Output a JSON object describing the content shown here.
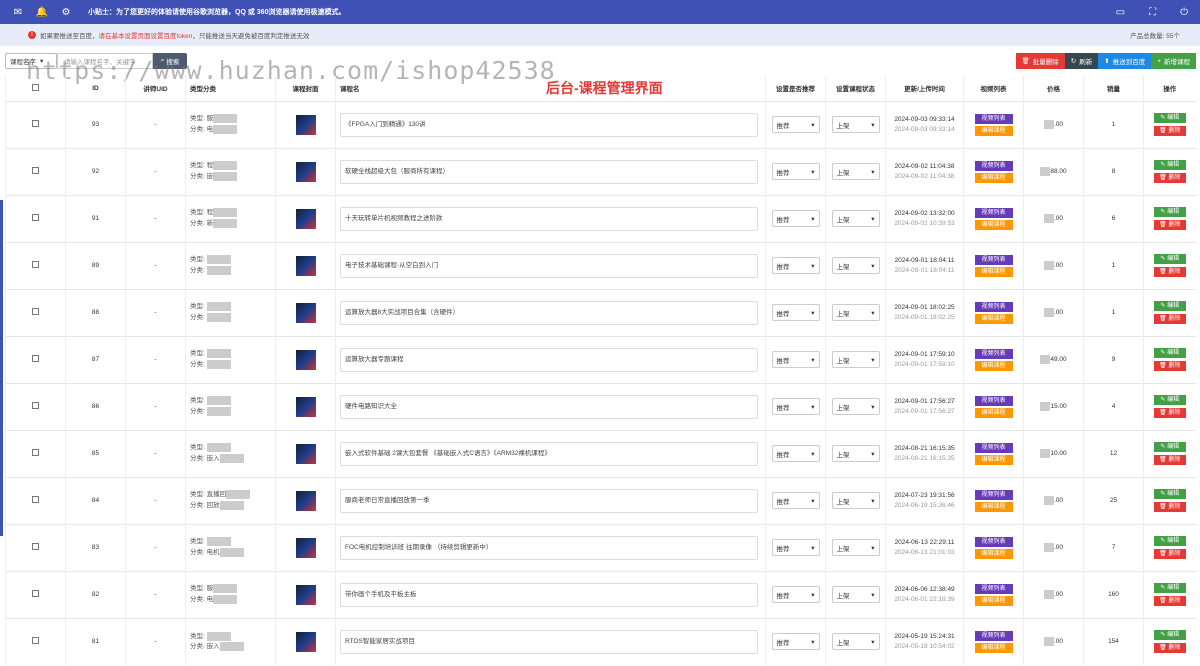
{
  "topbar": {
    "tip": "小贴士：为了您更好的体验请使用谷歌浏览器，QQ 或 360浏览器请使用极速模式。",
    "icons": [
      "mail-icon",
      "bell-icon",
      "gear-icon",
      "window-icon",
      "fullscreen-icon",
      "power-icon"
    ]
  },
  "notice": {
    "prefix": "如果要推送至百度，",
    "highlight": "请在基本设置页面设置百度token",
    "suffix": "，只能推送当天避免被百度判定推送无效",
    "product_count": "产品总数量: 55个"
  },
  "toolbar": {
    "select_field": "课程名字",
    "search_placeholder": "请输入课程名字、关键字",
    "search_label": "搜索",
    "batch_delete": "批量删除",
    "refresh": "刷新",
    "push_baidu": "推送到百度",
    "add_course": "新增课程"
  },
  "watermark": "https://www.huzhan.com/ishop42538",
  "page_title": "后台-课程管理界面",
  "table": {
    "headers": [
      "ID",
      "讲师UID",
      "类型分类",
      "课程封面",
      "课程名",
      "设置是否推荐",
      "设置课程状态",
      "更新/上传时间",
      "视频列表",
      "价格",
      "销量",
      "操作"
    ],
    "video_list_label": "视频列表",
    "edit_course_label": "编辑课程",
    "edit_label": "编辑",
    "delete_label": "删除",
    "rows": [
      {
        "id": "93",
        "uid": "-",
        "type1": "类型: 服",
        "type2": "分类: 电",
        "name": "《FPGA入门到精通》130讲",
        "recommend": "推荐",
        "status": "上架",
        "time1": "2024-09-03 09:33:14",
        "time2": "2024-09-03 09:33:14",
        "price": ".00",
        "sales": "1"
      },
      {
        "id": "92",
        "uid": "-",
        "type1": "类型: 程",
        "type2": "分类: 嵌",
        "name": "软硬全栈超级大包（服商所有课程）",
        "recommend": "推荐",
        "status": "上架",
        "time1": "2024-09-02 11:04:38",
        "time2": "2024-09-02 11:04:38",
        "price": "88.00",
        "sales": "8"
      },
      {
        "id": "91",
        "uid": "-",
        "type1": "类型: 程",
        "type2": "分类: 新",
        "name": "十天玩转单片机视频教程之进阶款",
        "recommend": "推荐",
        "status": "上架",
        "time1": "2024-09-02 13:32:00",
        "time2": "2024-09-02 10:39:53",
        "price": ".00",
        "sales": "6"
      },
      {
        "id": "89",
        "uid": "-",
        "type1": "类型: ",
        "type2": "分类: ",
        "name": "电子技术基础课程-从空白到入门",
        "recommend": "推荐",
        "status": "上架",
        "time1": "2024-09-01 18:04:11",
        "time2": "2024-09-01 18:04:11",
        "price": ".00",
        "sales": "1"
      },
      {
        "id": "88",
        "uid": "-",
        "type1": "类型: ",
        "type2": "分类: ",
        "name": "运算放大器8大实战项目合集（含硬件）",
        "recommend": "推荐",
        "status": "上架",
        "time1": "2024-09-01 18:02:25",
        "time2": "2024-09-01 18:02:25",
        "price": ".00",
        "sales": "1"
      },
      {
        "id": "87",
        "uid": "-",
        "type1": "类型: ",
        "type2": "分类: ",
        "name": "运算放大器专题课程",
        "recommend": "推荐",
        "status": "上架",
        "time1": "2024-09-01 17:59:10",
        "time2": "2024-09-01 17:59:10",
        "price": "49.00",
        "sales": "9"
      },
      {
        "id": "86",
        "uid": "-",
        "type1": "类型: ",
        "type2": "分类: ",
        "name": "硬件电路知识大全",
        "recommend": "推荐",
        "status": "上架",
        "time1": "2024-09-01 17:56:27",
        "time2": "2024-09-01 17:56:27",
        "price": "15.00",
        "sales": "4"
      },
      {
        "id": "85",
        "uid": "-",
        "type1": "类型: ",
        "type2": "分类: 嵌入",
        "name": "嵌入式软件基础 2课大包套餐 《基础嵌入式C语言》《ARM32裸机课程》",
        "recommend": "推荐",
        "status": "上架",
        "time1": "2024-08-21 16:15:35",
        "time2": "2024-08-21 16:15:35",
        "price": "10.00",
        "sales": "12"
      },
      {
        "id": "84",
        "uid": "-",
        "type1": "类型: 直播回",
        "type2": "分类: 回放",
        "name": "服商老师日常直播回放第一季",
        "recommend": "推荐",
        "status": "上架",
        "time1": "2024-07-23 19:31:56",
        "time2": "2024-06-19 15:36:46",
        "price": ".00",
        "sales": "25"
      },
      {
        "id": "83",
        "uid": "-",
        "type1": "类型: ",
        "type2": "分类: 电机",
        "name": "FOC电机控制培训班 往期录像 （持续剪辑更新中）",
        "recommend": "推荐",
        "status": "上架",
        "time1": "2024-06-13 22:29:11",
        "time2": "2024-06-13 21:01:03",
        "price": ".00",
        "sales": "7"
      },
      {
        "id": "82",
        "uid": "-",
        "type1": "类型: 服",
        "type2": "分类: 电",
        "name": "带你画个手机及平板主板",
        "recommend": "推荐",
        "status": "上架",
        "time1": "2024-06-06 12:38:49",
        "time2": "2024-06-01 22:18:39",
        "price": ".00",
        "sales": "160"
      },
      {
        "id": "81",
        "uid": "-",
        "type1": "类型: ",
        "type2": "分类: 嵌入",
        "name": "RTOS智能家居实战项目",
        "recommend": "推荐",
        "status": "上架",
        "time1": "2024-05-19 15:24:31",
        "time2": "2024-05-18 10:54:02",
        "price": ".00",
        "sales": "154"
      }
    ]
  }
}
